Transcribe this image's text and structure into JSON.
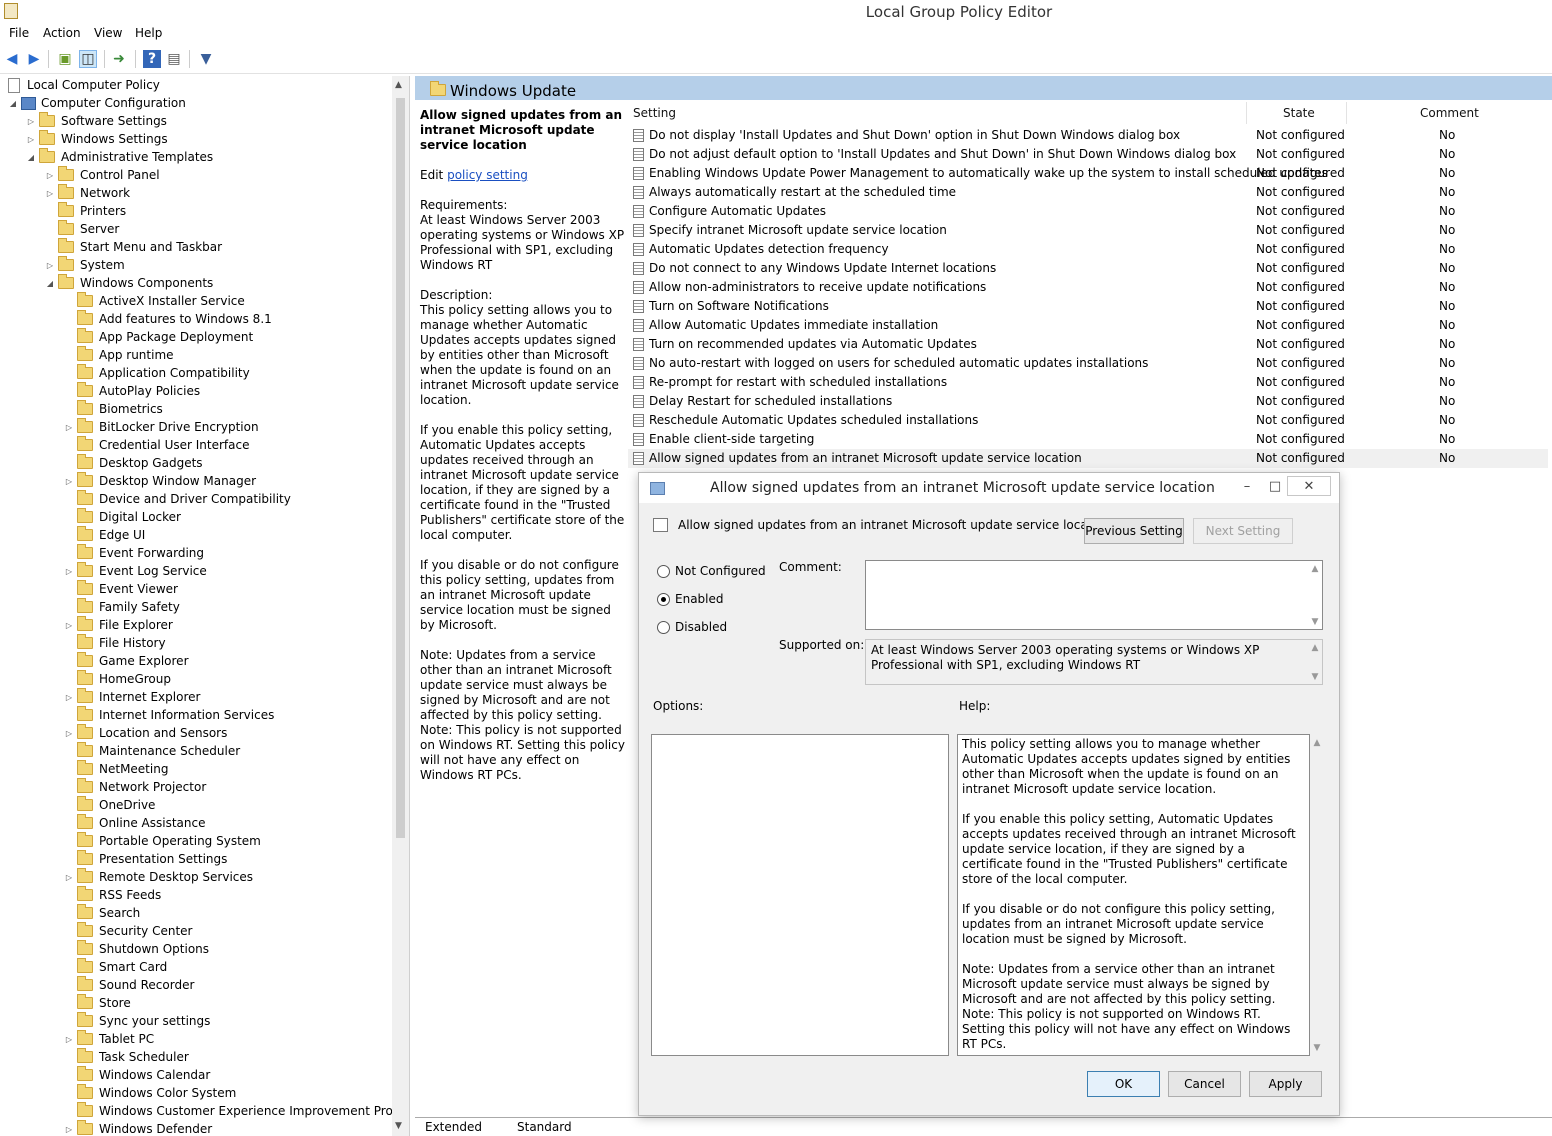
{
  "window": {
    "title": "Local Group Policy Editor"
  },
  "menu": [
    "File",
    "Action",
    "View",
    "Help"
  ],
  "tree": {
    "root": "Local Computer Policy",
    "computer_config": "Computer Configuration",
    "software_settings": "Software Settings",
    "windows_settings": "Windows Settings",
    "admin_templates": "Administrative Templates",
    "admin_children": [
      "Control Panel",
      "Network",
      "Printers",
      "Server",
      "Start Menu and Taskbar",
      "System",
      "Windows Components"
    ],
    "components": [
      "ActiveX Installer Service",
      "Add features to Windows 8.1",
      "App Package Deployment",
      "App runtime",
      "Application Compatibility",
      "AutoPlay Policies",
      "Biometrics",
      "BitLocker Drive Encryption",
      "Credential User Interface",
      "Desktop Gadgets",
      "Desktop Window Manager",
      "Device and Driver Compatibility",
      "Digital Locker",
      "Edge UI",
      "Event Forwarding",
      "Event Log Service",
      "Event Viewer",
      "Family Safety",
      "File Explorer",
      "File History",
      "Game Explorer",
      "HomeGroup",
      "Internet Explorer",
      "Internet Information Services",
      "Location and Sensors",
      "Maintenance Scheduler",
      "NetMeeting",
      "Network Projector",
      "OneDrive",
      "Online Assistance",
      "Portable Operating System",
      "Presentation Settings",
      "Remote Desktop Services",
      "RSS Feeds",
      "Search",
      "Security Center",
      "Shutdown Options",
      "Smart Card",
      "Sound Recorder",
      "Store",
      "Sync your settings",
      "Tablet PC",
      "Task Scheduler",
      "Windows Calendar",
      "Windows Color System",
      "Windows Customer Experience Improvement Program",
      "Windows Defender"
    ]
  },
  "pane": {
    "title": "Windows Update"
  },
  "description": {
    "heading": "Allow signed updates from an intranet Microsoft update service location",
    "edit_prefix": "Edit",
    "edit_link": "policy setting",
    "requirements": "Requirements:\nAt least Windows Server 2003 operating systems or Windows XP Professional with SP1, excluding Windows RT",
    "description": "Description:\nThis policy setting allows you to manage whether Automatic Updates accepts updates signed by entities other than Microsoft when the update is found on an intranet Microsoft update service location.",
    "enable": "If you enable this policy setting, Automatic Updates accepts updates received through an intranet Microsoft update service location, if they are signed by a certificate found in the \"Trusted Publishers\" certificate store of the local computer.",
    "disable": "If you disable or do not configure this policy setting, updates from an intranet Microsoft update service location must be signed by Microsoft.",
    "note": "Note: Updates from a service other than an intranet Microsoft update service must always be signed by Microsoft and are not affected by this policy setting.\nNote: This policy is not supported on Windows RT. Setting this policy will not have any effect on Windows RT PCs."
  },
  "list": {
    "columns": [
      "Setting",
      "State",
      "Comment"
    ],
    "rows": [
      {
        "name": "Do not display 'Install Updates and Shut Down' option in Shut Down Windows dialog box",
        "state": "Not configured",
        "comment": "No"
      },
      {
        "name": "Do not adjust default option to 'Install Updates and Shut Down' in Shut Down Windows dialog box",
        "state": "Not configured",
        "comment": "No"
      },
      {
        "name": "Enabling Windows Update Power Management to automatically wake up the system to install scheduled updates",
        "state": "Not configured",
        "comment": "No"
      },
      {
        "name": "Always automatically restart at the scheduled time",
        "state": "Not configured",
        "comment": "No"
      },
      {
        "name": "Configure Automatic Updates",
        "state": "Not configured",
        "comment": "No"
      },
      {
        "name": "Specify intranet Microsoft update service location",
        "state": "Not configured",
        "comment": "No"
      },
      {
        "name": "Automatic Updates detection frequency",
        "state": "Not configured",
        "comment": "No"
      },
      {
        "name": "Do not connect to any Windows Update Internet locations",
        "state": "Not configured",
        "comment": "No"
      },
      {
        "name": "Allow non-administrators to receive update notifications",
        "state": "Not configured",
        "comment": "No"
      },
      {
        "name": "Turn on Software Notifications",
        "state": "Not configured",
        "comment": "No"
      },
      {
        "name": "Allow Automatic Updates immediate installation",
        "state": "Not configured",
        "comment": "No"
      },
      {
        "name": "Turn on recommended updates via Automatic Updates",
        "state": "Not configured",
        "comment": "No"
      },
      {
        "name": "No auto-restart with logged on users for scheduled automatic updates installations",
        "state": "Not configured",
        "comment": "No"
      },
      {
        "name": "Re-prompt for restart with scheduled installations",
        "state": "Not configured",
        "comment": "No"
      },
      {
        "name": "Delay Restart for scheduled installations",
        "state": "Not configured",
        "comment": "No"
      },
      {
        "name": "Reschedule Automatic Updates scheduled installations",
        "state": "Not configured",
        "comment": "No"
      },
      {
        "name": "Enable client-side targeting",
        "state": "Not configured",
        "comment": "No"
      },
      {
        "name": "Allow signed updates from an intranet Microsoft update service location",
        "state": "Not configured",
        "comment": "No"
      }
    ]
  },
  "tabs": [
    "Extended",
    "Standard"
  ],
  "dialog": {
    "title": "Allow signed updates from an intranet Microsoft update service location",
    "policy_name": "Allow signed updates from an intranet Microsoft update service location",
    "prev": "Previous Setting",
    "next": "Next Setting",
    "radio_not_configured": "Not Configured",
    "radio_enabled": "Enabled",
    "radio_disabled": "Disabled",
    "selected": "Enabled",
    "comment_label": "Comment:",
    "supported_label": "Supported on:",
    "supported_text": "At least Windows Server 2003 operating systems or Windows XP Professional with SP1, excluding Windows RT",
    "options_label": "Options:",
    "help_label": "Help:",
    "help_text": "This policy setting allows you to manage whether Automatic Updates accepts updates signed by entities other than Microsoft when the update is found on an intranet Microsoft update service location.\n\nIf you enable this policy setting, Automatic Updates accepts updates received through an intranet Microsoft update service location, if they are signed by a certificate found in the \"Trusted Publishers\" certificate store of the local computer.\n\nIf you disable or do not configure this policy setting, updates from an intranet Microsoft update service location must be signed by Microsoft.\n\nNote: Updates from a service other than an intranet Microsoft update service must always be signed by Microsoft and are not affected by this policy setting.\nNote: This policy is not supported on Windows RT. Setting this policy will not have any effect on Windows RT PCs.",
    "ok": "OK",
    "cancel": "Cancel",
    "apply": "Apply"
  }
}
